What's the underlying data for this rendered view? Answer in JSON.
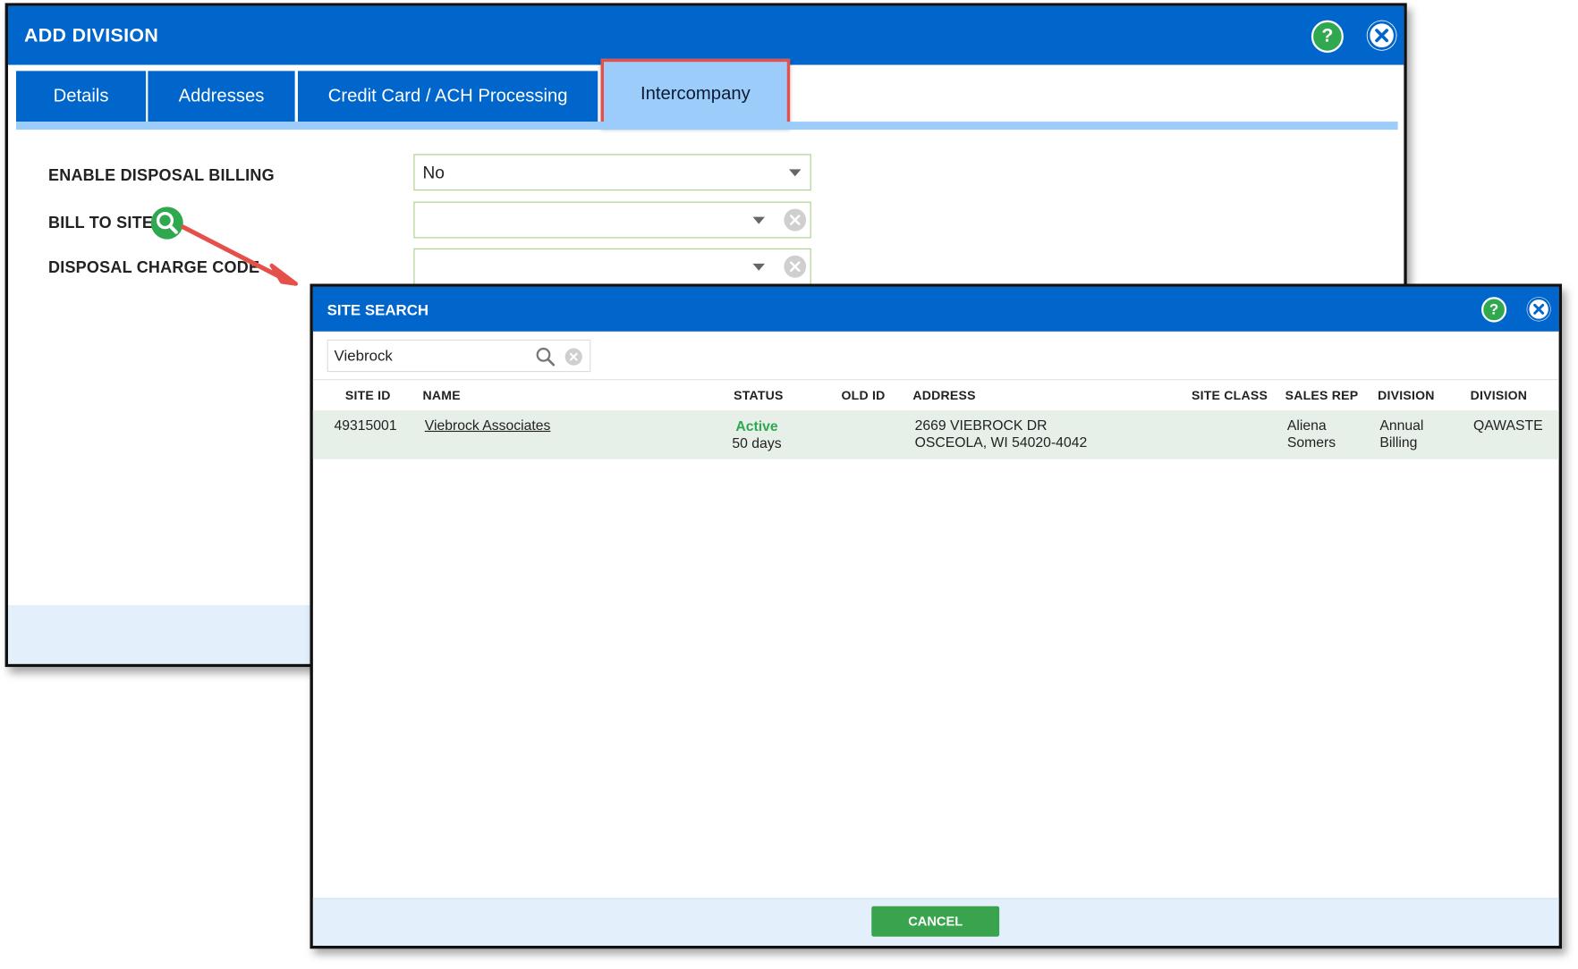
{
  "add_division": {
    "title": "ADD DIVISION",
    "help_label": "?",
    "tabs": [
      {
        "label": "Details"
      },
      {
        "label": "Addresses"
      },
      {
        "label": "Credit Card / ACH Processing"
      },
      {
        "label": "Intercompany",
        "active": true
      }
    ],
    "fields": {
      "enable_disposal_billing": {
        "label": "ENABLE DISPOSAL BILLING",
        "value": "No"
      },
      "bill_to_site": {
        "label": "BILL TO SITE",
        "value": ""
      },
      "disposal_charge_code": {
        "label": "DISPOSAL CHARGE CODE",
        "value": ""
      }
    },
    "highlight_color": "#e5514a"
  },
  "site_search": {
    "title": "SITE SEARCH",
    "help_label": "?",
    "search_value": "Viebrock",
    "columns": [
      "SITE ID",
      "NAME",
      "STATUS",
      "OLD ID",
      "ADDRESS",
      "SITE CLASS",
      "SALES REP",
      "DIVISION",
      "DIVISION"
    ],
    "rows": [
      {
        "site_id": "49315001",
        "name": "Viebrock Associates",
        "status": "Active",
        "status_detail": "50 days",
        "old_id": "",
        "address_line1": "2669 VIEBROCK DR",
        "address_line2": "OSCEOLA, WI 54020-4042",
        "site_class": "",
        "sales_rep_line1": "Aliena",
        "sales_rep_line2": "Somers",
        "division1_line1": "Annual",
        "division1_line2": "Billing",
        "division2": "QAWASTE"
      }
    ],
    "cancel_label": "CANCEL"
  },
  "colors": {
    "header_blue": "#0066cc",
    "tab_active": "#9ccdfa",
    "accent_green": "#2fa84f",
    "row_highlight": "#e6efe8"
  }
}
